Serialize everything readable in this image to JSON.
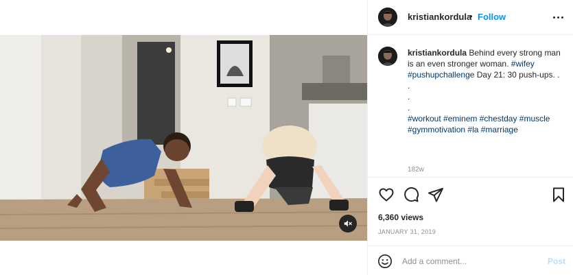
{
  "post": {
    "username": "kristiankordula",
    "separator": "•",
    "follow_label": "Follow"
  },
  "caption": {
    "username": "kristiankordula",
    "text_1": "Behind every strong man is an even stronger woman.",
    "tag_wifey": "#wifey",
    "tag_pushupchallenge": "#pushupchallenge",
    "text_2": "Day 21: 30 push-ups. .",
    "dot_1": ".",
    "dot_2": ".",
    "dot_3": ".",
    "tag_workout": "#workout",
    "tag_eminem": "#eminem",
    "tag_chestday": "#chestday",
    "tag_muscle": "#muscle",
    "tag_gymmotivation": "#gymmotivation",
    "tag_la": "#la",
    "tag_marriage": "#marriage",
    "age": "182w"
  },
  "stats": {
    "views": "6,360 views",
    "date": "JANUARY 31, 2019"
  },
  "comment": {
    "placeholder": "Add a comment...",
    "post_label": "Post"
  },
  "icons": {
    "more": "more-options-icon",
    "like": "heart-icon",
    "comment": "comment-icon",
    "share": "paper-plane-icon",
    "save": "bookmark-icon",
    "emoji": "emoji-icon",
    "mute": "speaker-muted-icon"
  },
  "colors": {
    "link": "#00376b",
    "follow": "#0095f6",
    "post_disabled": "#b2dffc",
    "muted_text": "#8e8e8e"
  }
}
